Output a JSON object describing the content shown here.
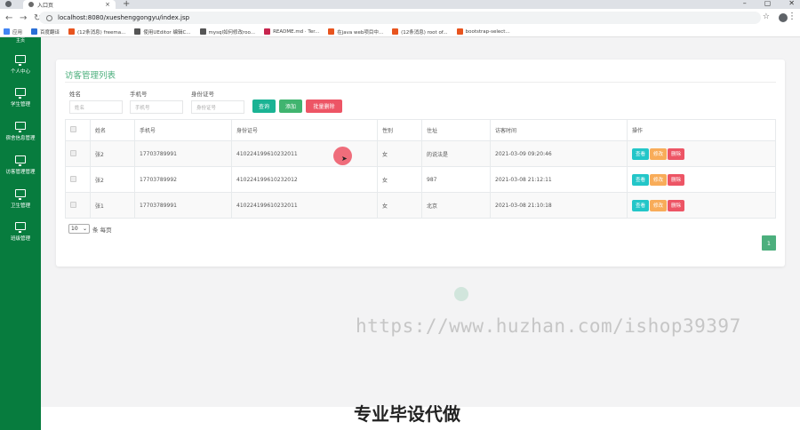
{
  "browser": {
    "tab_title": "入口页",
    "tab_close": "×",
    "new_tab": "+",
    "url": "localhost:8080/xueshenggongyu/index.jsp",
    "bookmarks": [
      {
        "label": "应用",
        "color": "#4285f4"
      },
      {
        "label": "百度翻译",
        "color": "#2a6fd6"
      },
      {
        "label": "(12条消息) freema...",
        "color": "#e8541e"
      },
      {
        "label": "使用UEditor 编辑C...",
        "color": "#555555"
      },
      {
        "label": "mysql如何修改roo...",
        "color": "#555555"
      },
      {
        "label": "README.md · Ter...",
        "color": "#c7254e"
      },
      {
        "label": "在java web项目中...",
        "color": "#e8541e"
      },
      {
        "label": "(12条消息) root of...",
        "color": "#e8541e"
      },
      {
        "label": "bootstrap-select...",
        "color": "#e8541e"
      }
    ]
  },
  "sidebar": {
    "cut_label": "主页",
    "items": [
      {
        "label": "个人中心"
      },
      {
        "label": "学生管理"
      },
      {
        "label": "宿舍信息管理"
      },
      {
        "label": "访客管理管理"
      },
      {
        "label": "卫生管理"
      },
      {
        "label": "班级管理"
      }
    ]
  },
  "page": {
    "title": "访客管理列表",
    "filters": {
      "name_label": "姓名",
      "name_placeholder": "姓名",
      "phone_label": "手机号",
      "phone_placeholder": "手机号",
      "id_label": "身份证号",
      "id_placeholder": "身份证号"
    },
    "buttons": {
      "query": "查询",
      "add": "添加",
      "batch_delete": "批量删除"
    },
    "table": {
      "headers": [
        "姓名",
        "手机号",
        "身份证号",
        "性别",
        "住址",
        "访客时间",
        "操作"
      ],
      "rows": [
        {
          "name": "张2",
          "phone": "17703789991",
          "id": "410224199610232011",
          "gender": "女",
          "address": "的说法是",
          "time": "2021-03-09 09:20:46"
        },
        {
          "name": "张2",
          "phone": "17703789992",
          "id": "410224199610232012",
          "gender": "女",
          "address": "987",
          "time": "2021-03-08 21:12:11"
        },
        {
          "name": "张1",
          "phone": "17703789991",
          "id": "410224199610232011",
          "gender": "女",
          "address": "北京",
          "time": "2021-03-08 21:10:18"
        }
      ],
      "ops": {
        "view": "查看",
        "edit": "修改",
        "delete": "删除"
      }
    },
    "per_page_value": "10",
    "per_page_suffix": "条 每页",
    "current_page": "1"
  },
  "overlay": {
    "watermark": "https://www.huzhan.com/ishop39397",
    "caption": "专业毕设代做"
  },
  "colors": {
    "sidebar": "#077c3e",
    "accent_green": "#4caf7d",
    "danger": "#ed5565",
    "warning": "#f8ac59",
    "info": "#23c6c8"
  }
}
